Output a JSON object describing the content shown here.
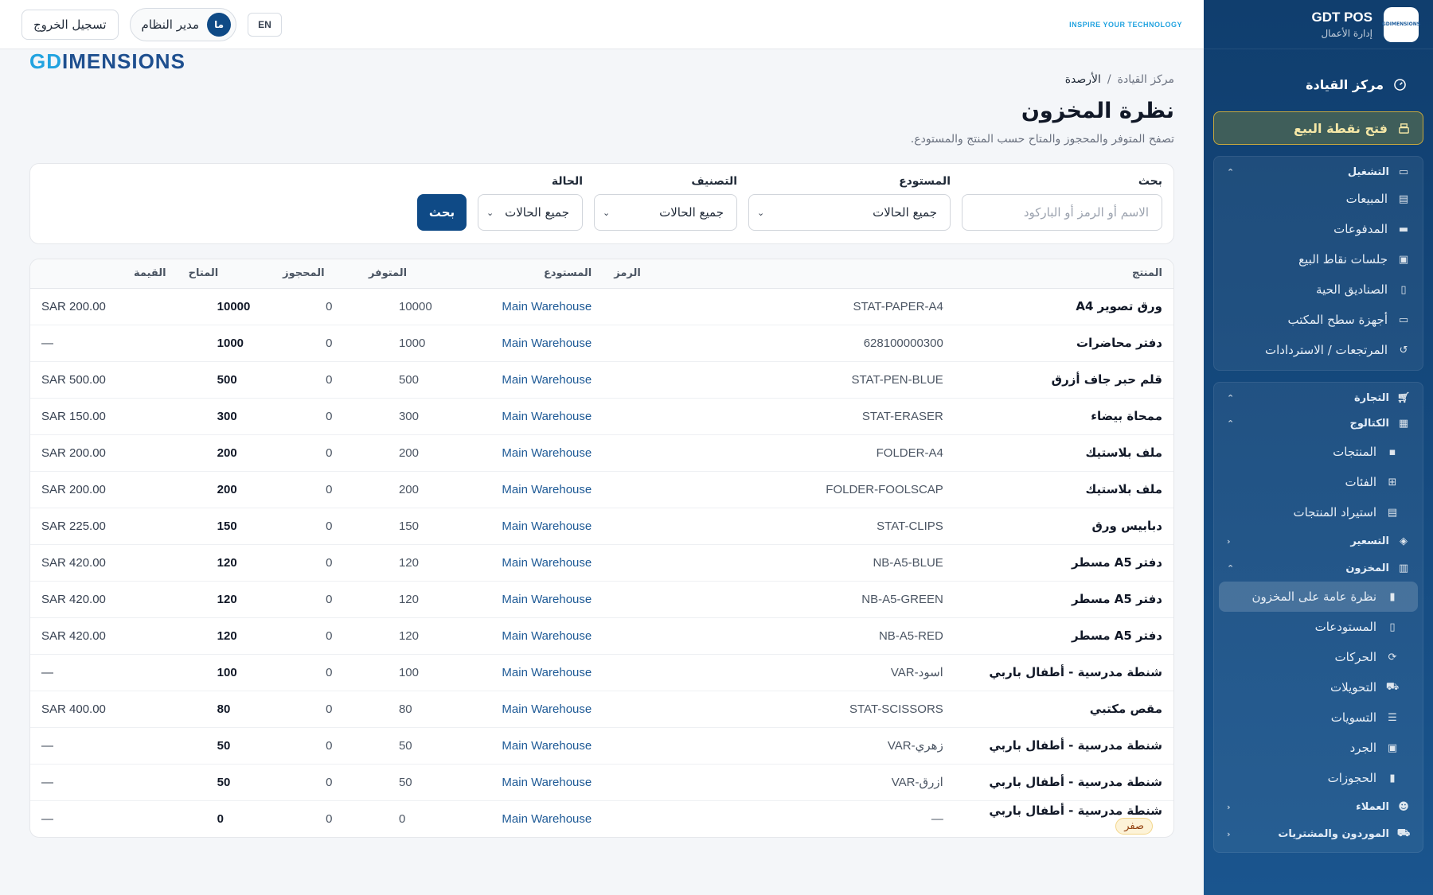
{
  "sidebar": {
    "brand_title": "GDT POS",
    "brand_subtitle": "إدارة الأعمال",
    "logo_text": "GDIMENSIONS",
    "command_center": "مركز القيادة",
    "open_pos": "فتح نقطة البيع",
    "operations": {
      "label": "التشغيل",
      "items": [
        "المبيعات",
        "المدفوعات",
        "جلسات نقاط البيع",
        "الصناديق الحية",
        "أجهزة سطح المكتب",
        "المرتجعات / الاستردادات"
      ]
    },
    "commerce": {
      "label": "التجارة",
      "catalog": {
        "label": "الكتالوج",
        "items": [
          "المنتجات",
          "الفئات",
          "استيراد المنتجات"
        ]
      },
      "pricing": "التسعير",
      "inventory": {
        "label": "المخزون",
        "items": [
          "نظرة عامة على المخزون",
          "المستودعات",
          "الحركات",
          "التحويلات",
          "التسويات",
          "الجرد",
          "الحجوزات"
        ]
      },
      "customers": "العملاء",
      "suppliers": "الموردون والمشتريات"
    }
  },
  "topbar": {
    "brand_main_accent": "GD",
    "brand_main": "IMENSIONS",
    "brand_tag": "INSPIRE YOUR TECHNOLOGY",
    "logout": "تسجيل الخروج",
    "user_initials": "ما",
    "user_name": "مدير النظام",
    "lang": "EN"
  },
  "breadcrumb": {
    "root": "مركز القيادة",
    "sep": "/",
    "current": "الأرصدة"
  },
  "page": {
    "title": "نظرة المخزون",
    "subtitle": "تصفح المتوفر والمحجوز والمتاح حسب المنتج والمستودع."
  },
  "filters": {
    "search_label": "بحث",
    "search_placeholder": "الاسم أو الرمز أو الباركود",
    "warehouse_label": "المستودع",
    "warehouse_value": "جميع الحالات",
    "category_label": "التصنيف",
    "category_value": "جميع الحالات",
    "status_label": "الحالة",
    "status_value": "جميع الحالات",
    "search_button": "بحث"
  },
  "table": {
    "headers": [
      "المنتج",
      "الرمز",
      "المستودع",
      "المتوفر",
      "المحجوز",
      "المتاح",
      "القيمة"
    ],
    "zero_badge": "صفر",
    "rows": [
      [
        "ورق تصوير A4",
        "STAT-PAPER-A4",
        "Main Warehouse",
        "10000",
        "0",
        "10000",
        "SAR 200.00"
      ],
      [
        "دفتر محاضرات",
        "628100000300",
        "Main Warehouse",
        "1000",
        "0",
        "1000",
        "—"
      ],
      [
        "قلم حبر جاف أزرق",
        "STAT-PEN-BLUE",
        "Main Warehouse",
        "500",
        "0",
        "500",
        "SAR 500.00"
      ],
      [
        "ممحاة بيضاء",
        "STAT-ERASER",
        "Main Warehouse",
        "300",
        "0",
        "300",
        "SAR 150.00"
      ],
      [
        "ملف بلاستيك",
        "FOLDER-A4",
        "Main Warehouse",
        "200",
        "0",
        "200",
        "SAR 200.00"
      ],
      [
        "ملف بلاستيك",
        "FOLDER-FOOLSCAP",
        "Main Warehouse",
        "200",
        "0",
        "200",
        "SAR 200.00"
      ],
      [
        "دبابيس ورق",
        "STAT-CLIPS",
        "Main Warehouse",
        "150",
        "0",
        "150",
        "SAR 225.00"
      ],
      [
        "دفتر A5 مسطر",
        "NB-A5-BLUE",
        "Main Warehouse",
        "120",
        "0",
        "120",
        "SAR 420.00"
      ],
      [
        "دفتر A5 مسطر",
        "NB-A5-GREEN",
        "Main Warehouse",
        "120",
        "0",
        "120",
        "SAR 420.00"
      ],
      [
        "دفتر A5 مسطر",
        "NB-A5-RED",
        "Main Warehouse",
        "120",
        "0",
        "120",
        "SAR 420.00"
      ],
      [
        "شنطة مدرسية - أطفال باربي",
        "VAR-اسود",
        "Main Warehouse",
        "100",
        "0",
        "100",
        "—"
      ],
      [
        "مقص مكتبي",
        "STAT-SCISSORS",
        "Main Warehouse",
        "80",
        "0",
        "80",
        "SAR 400.00"
      ],
      [
        "شنطة مدرسية - أطفال باربي",
        "VAR-زهري",
        "Main Warehouse",
        "50",
        "0",
        "50",
        "—"
      ],
      [
        "شنطة مدرسية - أطفال باربي",
        "VAR-ازرق",
        "Main Warehouse",
        "50",
        "0",
        "50",
        "—"
      ],
      [
        "شنطة مدرسية - أطفال باربي",
        "—",
        "Main Warehouse",
        "0",
        "0",
        "0",
        "—"
      ]
    ]
  },
  "colors": {
    "primary": "#0f4a86",
    "sidebar": "#103e6e",
    "accent": "#22a3e0",
    "link": "#1e5a96"
  }
}
